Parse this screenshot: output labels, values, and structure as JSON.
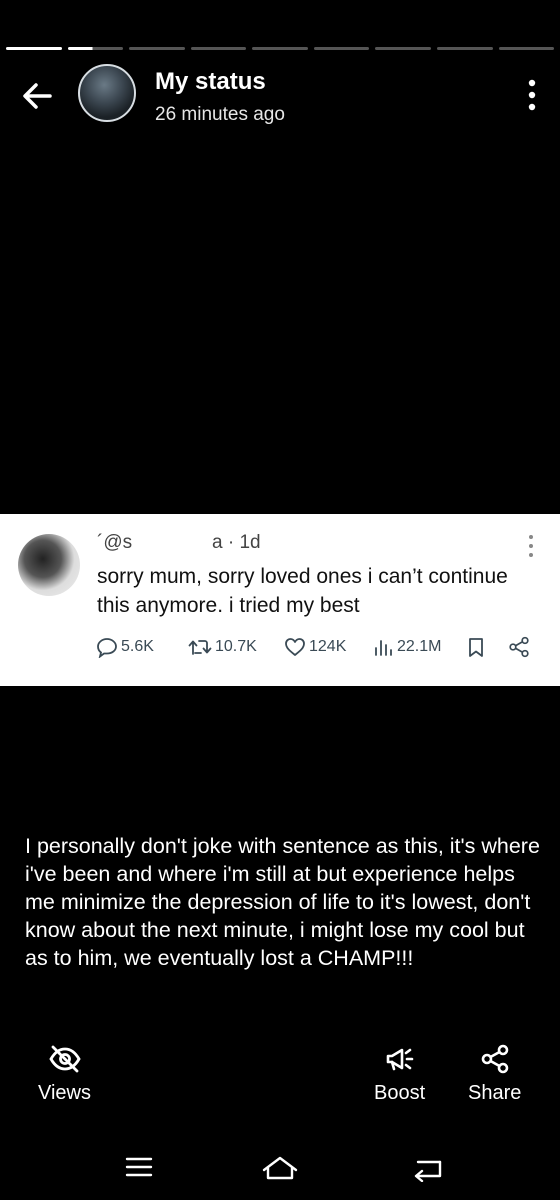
{
  "status": {
    "title": "My status",
    "time": "26 minutes ago",
    "segments": [
      "done",
      "half",
      "todo",
      "todo",
      "todo",
      "todo",
      "todo",
      "todo",
      "todo"
    ]
  },
  "tweet": {
    "handle": "´@s",
    "time": "a · 1d",
    "text": "sorry mum, sorry loved ones i can’t continue  this anymore. i tried my best",
    "replies": "5.6K",
    "reposts": "10.7K",
    "likes": "124K",
    "views": "22.1M"
  },
  "caption": "I personally don't joke with sentence as this, it's where i've been and where i'm still at but experience helps me minimize the depression of life to it's lowest, don't know about the next minute, i might lose my cool but as to him, we eventually lost a CHAMP!!!",
  "footer": {
    "views_label": "Views",
    "boost_label": "Boost",
    "share_label": "Share"
  },
  "icons": {
    "back": "arrow-left-icon",
    "menu": "more-vert-icon",
    "views": "eye-off-icon",
    "boost": "megaphone-icon",
    "share": "share-icon"
  },
  "colors": {
    "background": "#000000",
    "text": "#ffffff",
    "tweet_bg": "#ffffff",
    "tweet_meta": "#3a4a55"
  }
}
